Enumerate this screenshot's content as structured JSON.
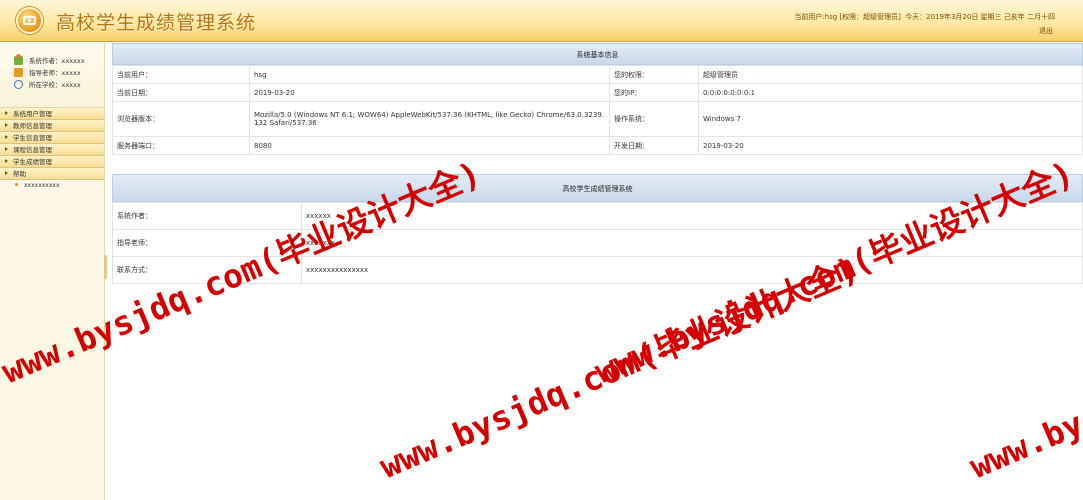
{
  "header": {
    "title": "高校学生成绩管理系统",
    "current_user_text": "当前用户:hsg [权限：超级管理员]",
    "today_text": "今天：2019年3月20日 星期三 己亥年 二月十四",
    "logout_label": "退出"
  },
  "sidebar": {
    "info": [
      {
        "label": "系统作者：xxxxxx",
        "icon": "author-icon"
      },
      {
        "label": "指导老师：xxxxx",
        "icon": "teacher-icon"
      },
      {
        "label": "所在学校：xxxxx",
        "icon": "school-icon"
      }
    ],
    "menu": [
      {
        "label": "系统用户管理"
      },
      {
        "label": "教师信息管理"
      },
      {
        "label": "学生信息管理"
      },
      {
        "label": "课程信息管理"
      },
      {
        "label": "学生成绩管理"
      },
      {
        "label": "帮助"
      }
    ],
    "help_sub": "xxxxxxxxxx"
  },
  "system_info": {
    "heading": "系统基本信息",
    "rows": [
      {
        "l1": "当前用户：",
        "v1": "hsg",
        "l2": "您的权限：",
        "v2": "超级管理员"
      },
      {
        "l1": "当前日期：",
        "v1": "2019-03-20",
        "l2": "您的IP：",
        "v2": "0:0:0:0:0:0:0:1"
      },
      {
        "l1": "浏览器版本：",
        "v1": "Mozilla/5.0 (Windows NT 6.1; WOW64) AppleWebKit/537.36 (KHTML, like Gecko) Chrome/63.0.3239.132 Safari/537.36",
        "l2": "操作系统：",
        "v2": "Windows 7"
      },
      {
        "l1": "服务器端口：",
        "v1": "8080",
        "l2": "开发日期：",
        "v2": "2019-03-20"
      }
    ]
  },
  "about": {
    "heading": "高校学生成绩管理系统",
    "rows": [
      {
        "label": "系统作者：",
        "value": "xxxxxx"
      },
      {
        "label": "指导老师：",
        "value": "xxxxxxx"
      },
      {
        "label": "联系方式：",
        "value": "xxxxxxxxxxxxxxx"
      }
    ]
  },
  "watermark": {
    "text": "www.bysjdq.com(毕业设计大全)"
  },
  "colors": {
    "header_title": "#b8730e",
    "watermark": "#d40000",
    "section_head": "#c9d9ea"
  }
}
